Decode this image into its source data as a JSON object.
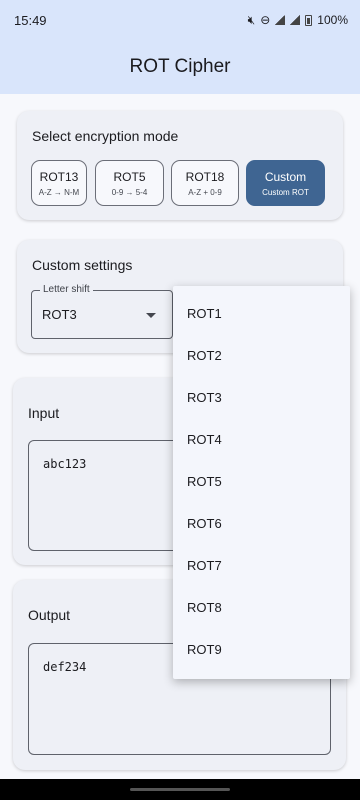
{
  "status_bar": {
    "time": "15:49",
    "battery": "100%",
    "icons": [
      "mute-icon",
      "dnd-icon",
      "signal-r-icon",
      "signal-icon",
      "battery-icon"
    ]
  },
  "app_bar": {
    "title": "ROT Cipher"
  },
  "mode_card": {
    "title": "Select encryption mode",
    "modes": [
      {
        "label": "ROT13",
        "sub": "A-Z → N-M",
        "selected": false
      },
      {
        "label": "ROT5",
        "sub": "0-9 → 5-4",
        "selected": false
      },
      {
        "label": "ROT18",
        "sub": "A-Z + 0-9",
        "selected": false
      },
      {
        "label": "Custom",
        "sub": "Custom ROT",
        "selected": true
      }
    ]
  },
  "custom_settings": {
    "title": "Custom settings",
    "letter_shift": {
      "label": "Letter shift",
      "value": "ROT3"
    }
  },
  "input": {
    "title": "Input",
    "value": "abc123"
  },
  "output": {
    "title": "Output",
    "value": "def234"
  },
  "dropdown_menu": {
    "items": [
      "ROT1",
      "ROT2",
      "ROT3",
      "ROT4",
      "ROT5",
      "ROT6",
      "ROT7",
      "ROT8",
      "ROT9"
    ]
  },
  "colors": {
    "app_bar": "#d9e5fb",
    "accent": "#3f6592",
    "card": "#eef0f6",
    "background": "#f7f8fc"
  }
}
